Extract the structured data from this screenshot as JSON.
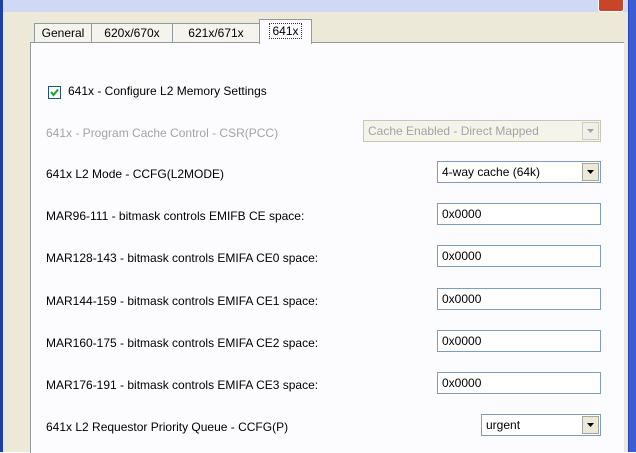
{
  "tabs": [
    "General",
    "620x/670x",
    "621x/671x",
    "641x"
  ],
  "configure": {
    "checked": true,
    "label": "641x - Configure L2 Memory Settings"
  },
  "pcc": {
    "label": "641x - Program Cache Control - CSR(PCC)",
    "value": "Cache Enabled - Direct Mapped",
    "disabled": true
  },
  "l2mode": {
    "label": "641x L2 Mode - CCFG(L2MODE)",
    "value": "4-way cache (64k)"
  },
  "mar": [
    {
      "label": "MAR96-111 - bitmask controls EMIFB CE space:",
      "value": "0x0000"
    },
    {
      "label": "MAR128-143 - bitmask controls EMIFA CE0 space:",
      "value": "0x0000"
    },
    {
      "label": "MAR144-159 - bitmask controls EMIFA CE1 space:",
      "value": "0x0000"
    },
    {
      "label": "MAR160-175 - bitmask controls EMIFA CE2 space:",
      "value": "0x0000"
    },
    {
      "label": "MAR176-191 - bitmask controls EMIFA CE3 space:",
      "value": "0x0000"
    }
  ],
  "priority": {
    "label": "641x L2 Requestor Priority Queue - CCFG(P)",
    "value": "urgent"
  },
  "colors": {
    "dialog": "#ece9d8",
    "panel": "#fcfcfe",
    "input_border": "#7f9db9",
    "window_frame": "#3a5cd6"
  }
}
